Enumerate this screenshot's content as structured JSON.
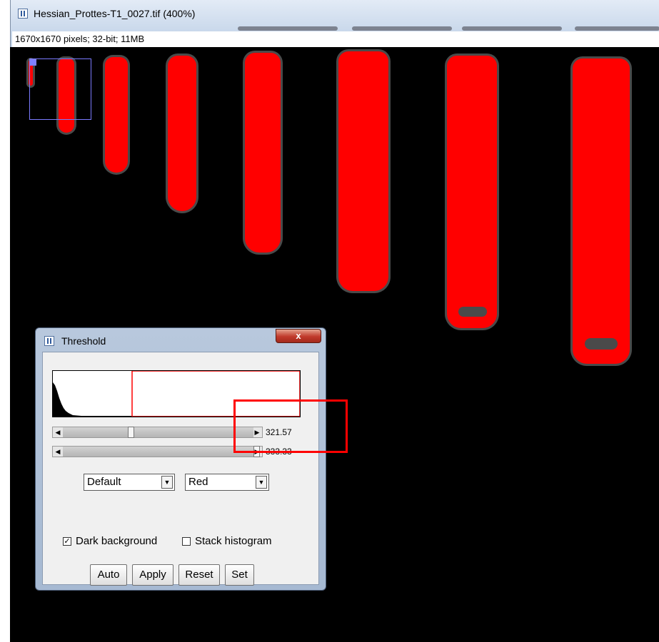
{
  "main_window": {
    "title": "Hessian_Prottes-T1_0027.tif (400%)",
    "info": "1670x1670 pixels; 32-bit; 11MB"
  },
  "threshold": {
    "title": "Threshold",
    "close_label": "x",
    "min_value": "321.57",
    "max_value": "333.33",
    "method": "Default",
    "display": "Red",
    "dark_background": {
      "label": "Dark background",
      "checked": true
    },
    "stack_histogram": {
      "label": "Stack histogram",
      "checked": false
    },
    "buttons": {
      "auto": "Auto",
      "apply": "Apply",
      "reset": "Reset",
      "set": "Set"
    }
  },
  "colors": {
    "threshold_overlay": "#ff0000",
    "background": "#000000"
  }
}
